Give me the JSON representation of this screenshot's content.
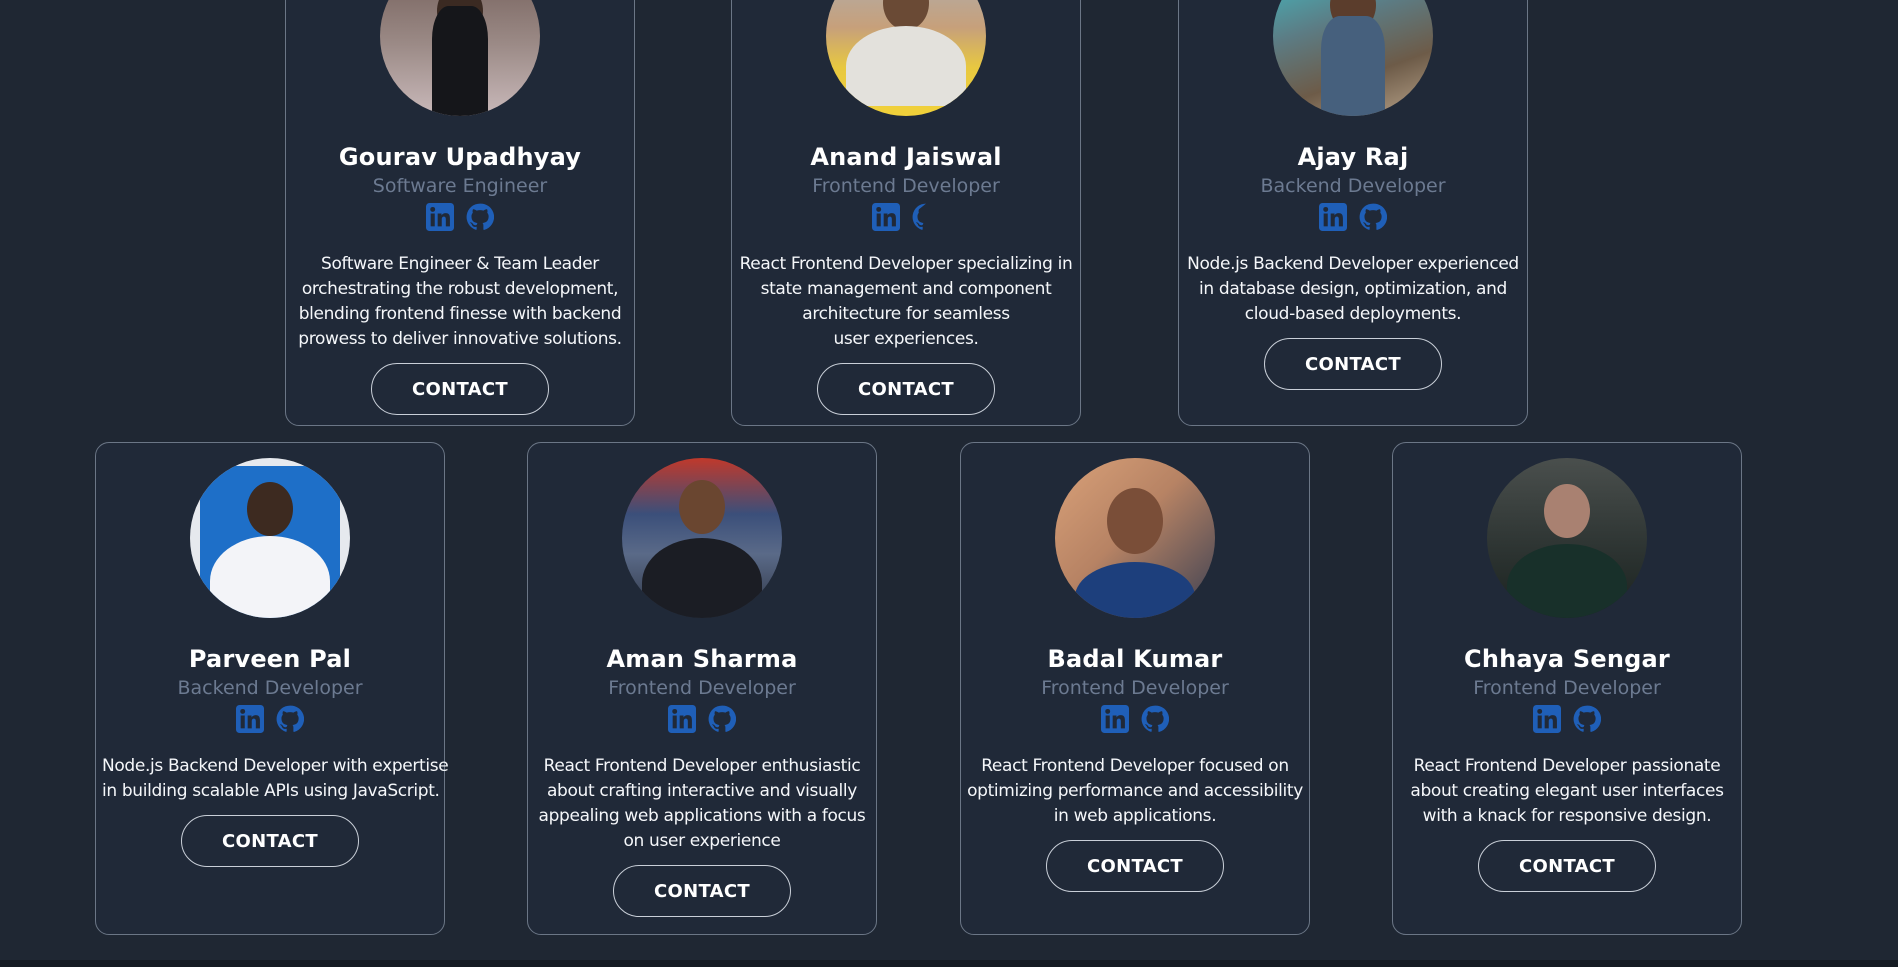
{
  "colors": {
    "background": "#1f2733",
    "card_bg": "#202938",
    "card_border": "#6b7686",
    "role_text": "#6c7a91",
    "social_icon": "#1f5fb8"
  },
  "row1": [
    {
      "name": "Gourav Upadhyay",
      "role": "Software Engineer",
      "desc": [
        "Software Engineer & Team Leader",
        "orchestrating the robust development,",
        "blending frontend finesse with backend",
        "prowess to deliver innovative solutions."
      ],
      "contact": "CONTACT",
      "icons": [
        "linkedin-icon",
        "github-icon"
      ]
    },
    {
      "name": "Anand Jaiswal",
      "role": "Frontend Developer",
      "desc": [
        "React Frontend Developer specializing in",
        "state management and component",
        "architecture for seamless",
        "user experiences."
      ],
      "contact": "CONTACT",
      "icons": [
        "linkedin-icon",
        "github-icon"
      ]
    },
    {
      "name": "Ajay Raj",
      "role": "Backend Developer",
      "desc": [
        "Node.js Backend Developer experienced",
        "in database design, optimization, and",
        "cloud-based deployments."
      ],
      "contact": "CONTACT",
      "icons": [
        "linkedin-icon",
        "github-icon"
      ]
    }
  ],
  "row2": [
    {
      "name": "Parveen Pal",
      "role": "Backend Developer",
      "desc": [
        "Node.js Backend Developer with expertise",
        "in building scalable APIs using JavaScript."
      ],
      "contact": "CONTACT",
      "icons": [
        "linkedin-icon",
        "github-icon"
      ]
    },
    {
      "name": "Aman Sharma",
      "role": "Frontend Developer",
      "desc": [
        "React Frontend Developer enthusiastic",
        "about crafting interactive and visually",
        "appealing web applications with a focus",
        "on user experience"
      ],
      "contact": "CONTACT",
      "icons": [
        "linkedin-icon",
        "github-icon"
      ]
    },
    {
      "name": "Badal Kumar",
      "role": "Frontend Developer",
      "desc": [
        "React Frontend Developer focused on",
        "optimizing performance and accessibility",
        "in web applications."
      ],
      "contact": "CONTACT",
      "icons": [
        "linkedin-icon",
        "github-icon"
      ]
    },
    {
      "name": "Chhaya Sengar",
      "role": "Frontend Developer",
      "desc": [
        "React Frontend Developer passionate",
        "about creating elegant user interfaces",
        "with a knack for responsive design."
      ],
      "contact": "CONTACT",
      "icons": [
        "linkedin-icon",
        "github-icon"
      ]
    }
  ]
}
